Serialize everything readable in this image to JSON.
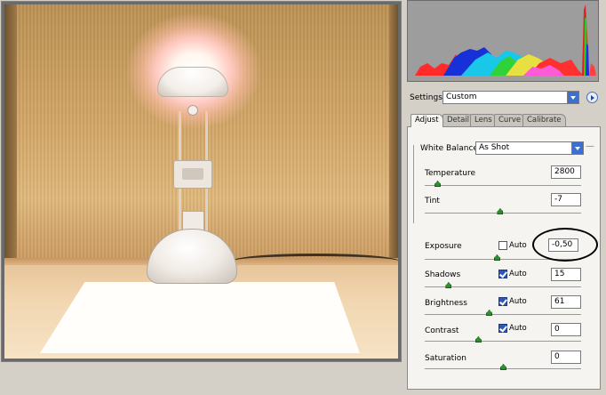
{
  "preview": {
    "image_description_icon": "lamp-photo"
  },
  "settings": {
    "label": "Settings:",
    "value": "Custom"
  },
  "tabs": [
    {
      "label": "Adjust",
      "active": true
    },
    {
      "label": "Detail",
      "active": false
    },
    {
      "label": "Lens",
      "active": false
    },
    {
      "label": "Curve",
      "active": false
    },
    {
      "label": "Calibrate",
      "active": false
    }
  ],
  "white_balance": {
    "label": "White Balance:",
    "value": "As Shot"
  },
  "controls": {
    "temperature": {
      "label": "Temperature",
      "value": "2800",
      "slider_level": 0.08
    },
    "tint": {
      "label": "Tint",
      "value": "-7",
      "slider_level": 0.48
    },
    "exposure": {
      "label": "Exposure",
      "value": "-0,50",
      "auto_label": "Auto",
      "auto_checked": false,
      "slider_level": 0.46
    },
    "shadows": {
      "label": "Shadows",
      "value": "15",
      "auto_label": "Auto",
      "auto_checked": true,
      "slider_level": 0.15
    },
    "brightness": {
      "label": "Brightness",
      "value": "61",
      "auto_label": "Auto",
      "auto_checked": true,
      "slider_level": 0.41
    },
    "contrast": {
      "label": "Contrast",
      "value": "0",
      "auto_label": "Auto",
      "auto_checked": true,
      "slider_level": 0.34
    },
    "saturation": {
      "label": "Saturation",
      "value": "0",
      "slider_level": 0.5
    }
  },
  "colors": {
    "panel_bg": "#f5f4f0",
    "slider_thumb": "#2f8c2f",
    "checkbox_checked": "#2d58b8",
    "histogram_bg": "#9d9d9d"
  }
}
